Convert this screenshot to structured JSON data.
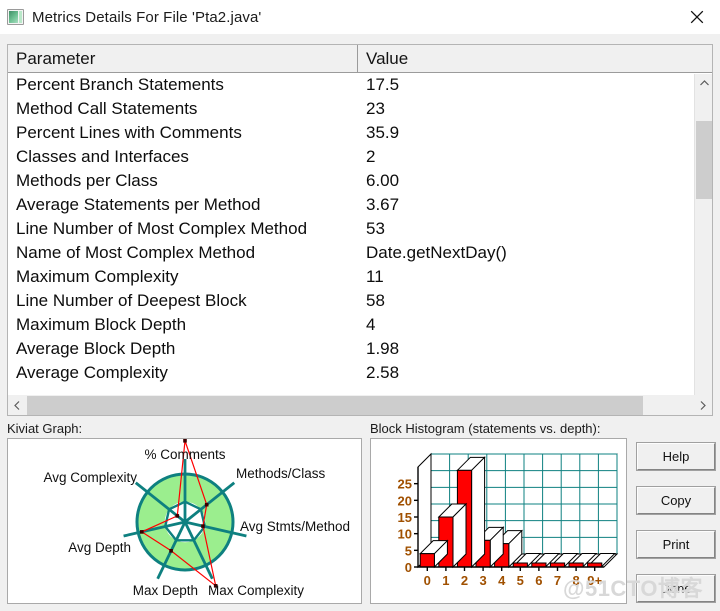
{
  "window": {
    "title": "Metrics Details For File 'Pta2.java'",
    "icon": "metrics-app-icon",
    "close_icon": "close-icon"
  },
  "table": {
    "columns": [
      "Parameter",
      "Value"
    ],
    "rows": [
      {
        "parameter": "Percent Branch Statements",
        "value": "17.5"
      },
      {
        "parameter": "Method Call Statements",
        "value": "23"
      },
      {
        "parameter": "Percent Lines with Comments",
        "value": "35.9"
      },
      {
        "parameter": "Classes and Interfaces",
        "value": "2"
      },
      {
        "parameter": "Methods per Class",
        "value": "6.00"
      },
      {
        "parameter": "Average Statements per Method",
        "value": "3.67"
      },
      {
        "parameter": "Line Number of Most Complex Method",
        "value": "53"
      },
      {
        "parameter": "Name of Most Complex Method",
        "value": "Date.getNextDay()"
      },
      {
        "parameter": "Maximum Complexity",
        "value": "11"
      },
      {
        "parameter": "Line Number of Deepest Block",
        "value": "58"
      },
      {
        "parameter": "Maximum Block Depth",
        "value": "4"
      },
      {
        "parameter": "Average Block Depth",
        "value": "1.98"
      },
      {
        "parameter": "Average Complexity",
        "value": "2.58"
      }
    ]
  },
  "scrollbars": {
    "vertical": {
      "up_icon": "chevron-up-icon",
      "down_icon": "chevron-down-icon"
    },
    "horizontal": {
      "left_icon": "chevron-left-icon",
      "right_icon": "chevron-right-icon"
    }
  },
  "sections": {
    "kiviat_label": "Kiviat Graph:",
    "histogram_label": "Block Histogram (statements vs. depth):"
  },
  "buttons": {
    "help": "Help",
    "copy": "Copy",
    "print": "Print",
    "done": "Done"
  },
  "watermark": "@51CTO博客",
  "colors": {
    "kiviat_fill": "#9BEE8E",
    "kiviat_stroke": "#0E8080",
    "kiviat_series": "#FF0000",
    "bar_fill": "#FF0000",
    "grid": "#0E8080",
    "axis_text": "#A05000",
    "window_bg": "#F0F0F0"
  },
  "chart_data": [
    {
      "type": "radar",
      "name": "kiviat-graph",
      "title": "Kiviat Graph:",
      "categories": [
        "% Comments",
        "Methods/Class",
        "Avg Stmts/Method",
        "Max Complexity",
        "Max Depth",
        "Avg Depth",
        "Avg Complexity"
      ],
      "series": [
        {
          "name": "metrics",
          "values": [
            1.32,
            0.45,
            0.3,
            1.15,
            0.52,
            0.72,
            0.16
          ]
        }
      ],
      "band": {
        "inner": 0.33,
        "outer": 0.78,
        "fill": "#9BEE8E"
      },
      "rmax": 1.4,
      "grid": true,
      "legend": "none"
    },
    {
      "type": "bar",
      "name": "block-histogram",
      "title": "Block Histogram (statements vs. depth):",
      "categories": [
        "0",
        "1",
        "2",
        "3",
        "4",
        "5",
        "6",
        "7",
        "8",
        "9+"
      ],
      "values": [
        4,
        15,
        29,
        8,
        7,
        0,
        0,
        0,
        0,
        0
      ],
      "xlabel": "depth",
      "ylabel": "statements",
      "yticks": [
        0,
        5,
        10,
        15,
        20,
        25
      ],
      "ylim": [
        0,
        30
      ],
      "grid": true,
      "legend": "none",
      "style": "3d"
    }
  ]
}
